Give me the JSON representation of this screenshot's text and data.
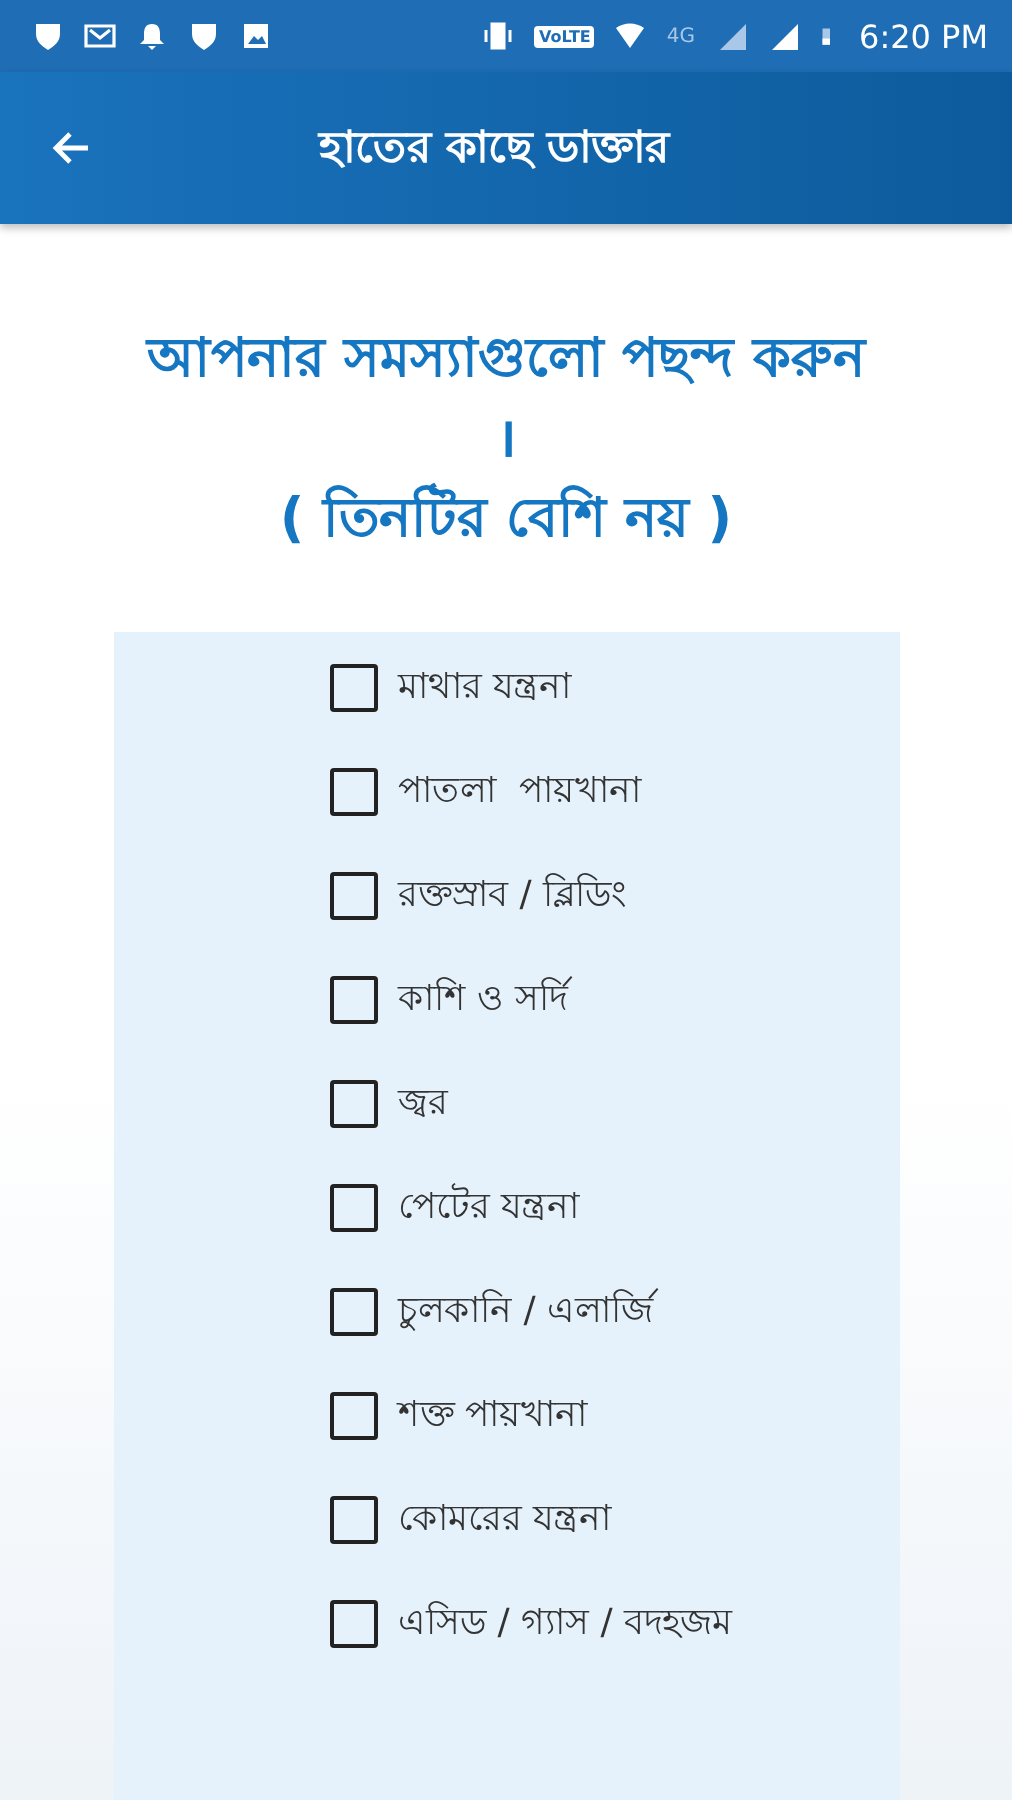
{
  "status_bar": {
    "network_type": "4G",
    "volte": "VoLTE",
    "time": "6:20 PM"
  },
  "app_bar": {
    "title": "হাতের কাছে ডাক্তার"
  },
  "heading": {
    "line_1": "আপনার সমস্যাগুলো পছন্দ করুন",
    "line_2": "।",
    "line_3": "( তিনটির বেশি নয় )"
  },
  "symptoms": [
    {
      "label": "মাথার যন্ত্রনা",
      "checked": false
    },
    {
      "label": "পাতলা  পায়খানা",
      "checked": false
    },
    {
      "label": "রক্তস্রাব / ব্লিডিং",
      "checked": false
    },
    {
      "label": "কাশি ও সর্দি",
      "checked": false
    },
    {
      "label": "জ্বর",
      "checked": false
    },
    {
      "label": "পেটের যন্ত্রনা",
      "checked": false
    },
    {
      "label": "চুলকানি / এলার্জি",
      "checked": false
    },
    {
      "label": "শক্ত পায়খানা",
      "checked": false
    },
    {
      "label": "কোমরের যন্ত্রনা",
      "checked": false
    },
    {
      "label": "এসিড / গ্যাস / বদহজম",
      "checked": false
    }
  ]
}
